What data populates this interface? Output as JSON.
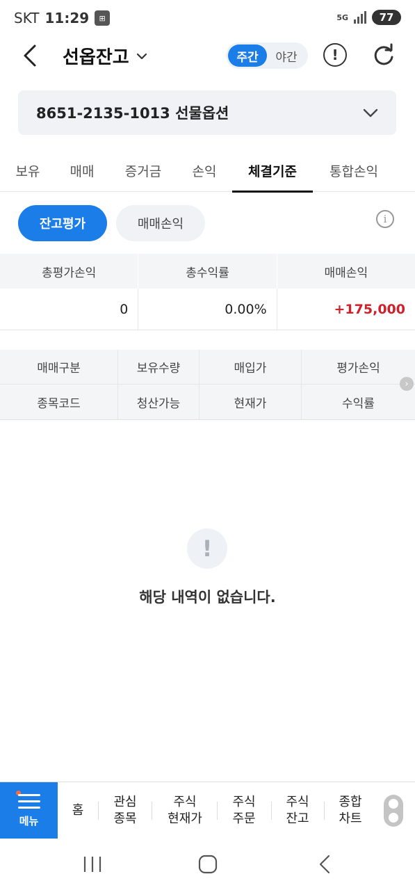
{
  "status_bar": {
    "carrier": "SKT",
    "time": "11:29",
    "network": "5G",
    "battery": "77"
  },
  "header": {
    "title": "선옵잔고",
    "session_toggle": {
      "day": "주간",
      "night": "야간",
      "active": "day"
    },
    "alert_symbol": "!"
  },
  "account": {
    "label": "8651-2135-1013 선물옵션"
  },
  "tabs": [
    {
      "label": "보유"
    },
    {
      "label": "매매"
    },
    {
      "label": "증거금"
    },
    {
      "label": "손익"
    },
    {
      "label": "체결기준",
      "active": true
    },
    {
      "label": "통합손익"
    }
  ],
  "filters": {
    "balance_eval": "잔고평가",
    "trade_pnl": "매매손익",
    "active": "balance_eval"
  },
  "summary": {
    "headers": [
      "총평가손익",
      "총수익률",
      "매매손익"
    ],
    "values": [
      "0",
      "0.00%",
      "+175,000"
    ]
  },
  "detail_table": {
    "row1": [
      "매매구분",
      "보유수량",
      "매입가",
      "평가손익"
    ],
    "row2": [
      "종목코드",
      "청산가능",
      "현재가",
      "수익률"
    ]
  },
  "empty_state": {
    "icon_symbol": "!",
    "message": "해당 내역이 없습니다."
  },
  "bottom_menu": {
    "menu_label": "메뉴",
    "items": [
      {
        "label": "홈"
      },
      {
        "label": "관심\n종목"
      },
      {
        "label": "주식\n현재가"
      },
      {
        "label": "주식\n주문"
      },
      {
        "label": "주식\n잔고"
      },
      {
        "label": "종합\n차트"
      }
    ]
  },
  "colors": {
    "accent": "#1a7de8",
    "positive": "#d0202a",
    "panel": "#f0f2f6"
  },
  "icons": {
    "back": "back-arrow-icon",
    "dropdown": "chevron-down-icon",
    "alert": "exclamation-circle-icon",
    "refresh": "refresh-icon",
    "info": "info-icon",
    "menu": "hamburger-icon"
  }
}
